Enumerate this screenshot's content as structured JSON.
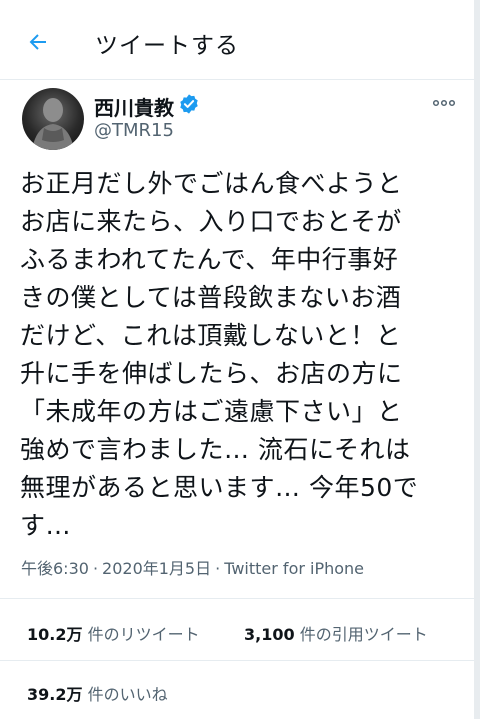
{
  "header": {
    "back_icon": "arrow-left-icon",
    "title": "ツイートする"
  },
  "profile": {
    "display_name": "西川貴教",
    "handle": "@TMR15",
    "verified_icon": "verified-badge-icon",
    "more_icon": "more-options-icon"
  },
  "tweet": {
    "text": "お正月だし外でごはん食べようと\nお店に来たら、入り口でおとそが\nふるまわれてたんで、年中行事好\nきの僕としては普段飲まないお酒\nだけど、これは頂戴しないと！と\n升に手を伸ばしたら、お店の方に\n「未成年の方はご遠慮下さい」と\n強めで言わました… 流石にそれは\n無理があると思います… 今年50で\nす…",
    "time": "午後6:30",
    "separator": "·",
    "date": "2020年1月5日",
    "source": "Twitter for iPhone"
  },
  "stats": {
    "retweets_count": "10.2万",
    "retweets_label": "件のリツイート",
    "quotes_count": "3,100",
    "quotes_label": "件の引用ツイート",
    "likes_count": "39.2万",
    "likes_label": "件のいいね"
  },
  "colors": {
    "accent": "#1d9bf0",
    "text": "#0f1419",
    "secondary_text": "#536471",
    "divider": "#e6ecf0"
  }
}
